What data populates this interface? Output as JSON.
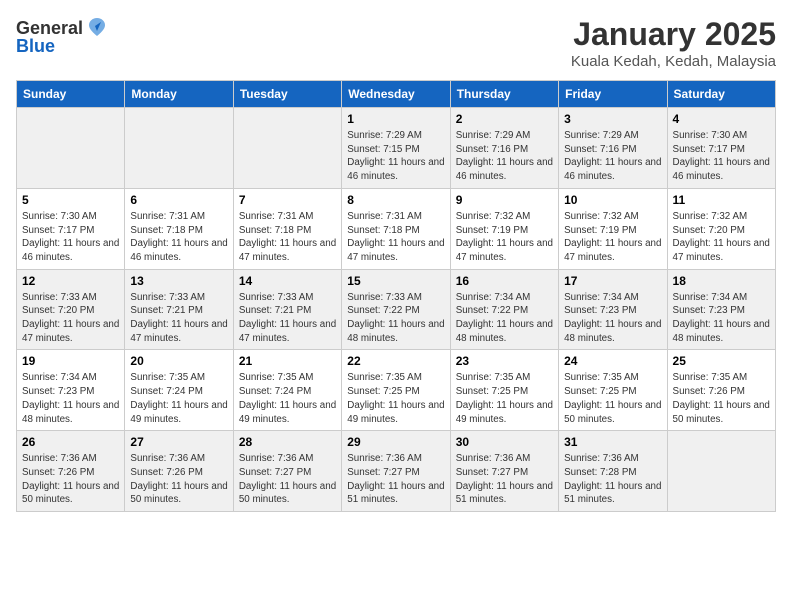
{
  "logo": {
    "general": "General",
    "blue": "Blue"
  },
  "title": "January 2025",
  "location": "Kuala Kedah, Kedah, Malaysia",
  "weekdays": [
    "Sunday",
    "Monday",
    "Tuesday",
    "Wednesday",
    "Thursday",
    "Friday",
    "Saturday"
  ],
  "weeks": [
    [
      {
        "day": "",
        "sunrise": "",
        "sunset": "",
        "daylight": ""
      },
      {
        "day": "",
        "sunrise": "",
        "sunset": "",
        "daylight": ""
      },
      {
        "day": "",
        "sunrise": "",
        "sunset": "",
        "daylight": ""
      },
      {
        "day": "1",
        "sunrise": "Sunrise: 7:29 AM",
        "sunset": "Sunset: 7:15 PM",
        "daylight": "Daylight: 11 hours and 46 minutes."
      },
      {
        "day": "2",
        "sunrise": "Sunrise: 7:29 AM",
        "sunset": "Sunset: 7:16 PM",
        "daylight": "Daylight: 11 hours and 46 minutes."
      },
      {
        "day": "3",
        "sunrise": "Sunrise: 7:29 AM",
        "sunset": "Sunset: 7:16 PM",
        "daylight": "Daylight: 11 hours and 46 minutes."
      },
      {
        "day": "4",
        "sunrise": "Sunrise: 7:30 AM",
        "sunset": "Sunset: 7:17 PM",
        "daylight": "Daylight: 11 hours and 46 minutes."
      }
    ],
    [
      {
        "day": "5",
        "sunrise": "Sunrise: 7:30 AM",
        "sunset": "Sunset: 7:17 PM",
        "daylight": "Daylight: 11 hours and 46 minutes."
      },
      {
        "day": "6",
        "sunrise": "Sunrise: 7:31 AM",
        "sunset": "Sunset: 7:18 PM",
        "daylight": "Daylight: 11 hours and 46 minutes."
      },
      {
        "day": "7",
        "sunrise": "Sunrise: 7:31 AM",
        "sunset": "Sunset: 7:18 PM",
        "daylight": "Daylight: 11 hours and 47 minutes."
      },
      {
        "day": "8",
        "sunrise": "Sunrise: 7:31 AM",
        "sunset": "Sunset: 7:18 PM",
        "daylight": "Daylight: 11 hours and 47 minutes."
      },
      {
        "day": "9",
        "sunrise": "Sunrise: 7:32 AM",
        "sunset": "Sunset: 7:19 PM",
        "daylight": "Daylight: 11 hours and 47 minutes."
      },
      {
        "day": "10",
        "sunrise": "Sunrise: 7:32 AM",
        "sunset": "Sunset: 7:19 PM",
        "daylight": "Daylight: 11 hours and 47 minutes."
      },
      {
        "day": "11",
        "sunrise": "Sunrise: 7:32 AM",
        "sunset": "Sunset: 7:20 PM",
        "daylight": "Daylight: 11 hours and 47 minutes."
      }
    ],
    [
      {
        "day": "12",
        "sunrise": "Sunrise: 7:33 AM",
        "sunset": "Sunset: 7:20 PM",
        "daylight": "Daylight: 11 hours and 47 minutes."
      },
      {
        "day": "13",
        "sunrise": "Sunrise: 7:33 AM",
        "sunset": "Sunset: 7:21 PM",
        "daylight": "Daylight: 11 hours and 47 minutes."
      },
      {
        "day": "14",
        "sunrise": "Sunrise: 7:33 AM",
        "sunset": "Sunset: 7:21 PM",
        "daylight": "Daylight: 11 hours and 47 minutes."
      },
      {
        "day": "15",
        "sunrise": "Sunrise: 7:33 AM",
        "sunset": "Sunset: 7:22 PM",
        "daylight": "Daylight: 11 hours and 48 minutes."
      },
      {
        "day": "16",
        "sunrise": "Sunrise: 7:34 AM",
        "sunset": "Sunset: 7:22 PM",
        "daylight": "Daylight: 11 hours and 48 minutes."
      },
      {
        "day": "17",
        "sunrise": "Sunrise: 7:34 AM",
        "sunset": "Sunset: 7:23 PM",
        "daylight": "Daylight: 11 hours and 48 minutes."
      },
      {
        "day": "18",
        "sunrise": "Sunrise: 7:34 AM",
        "sunset": "Sunset: 7:23 PM",
        "daylight": "Daylight: 11 hours and 48 minutes."
      }
    ],
    [
      {
        "day": "19",
        "sunrise": "Sunrise: 7:34 AM",
        "sunset": "Sunset: 7:23 PM",
        "daylight": "Daylight: 11 hours and 48 minutes."
      },
      {
        "day": "20",
        "sunrise": "Sunrise: 7:35 AM",
        "sunset": "Sunset: 7:24 PM",
        "daylight": "Daylight: 11 hours and 49 minutes."
      },
      {
        "day": "21",
        "sunrise": "Sunrise: 7:35 AM",
        "sunset": "Sunset: 7:24 PM",
        "daylight": "Daylight: 11 hours and 49 minutes."
      },
      {
        "day": "22",
        "sunrise": "Sunrise: 7:35 AM",
        "sunset": "Sunset: 7:25 PM",
        "daylight": "Daylight: 11 hours and 49 minutes."
      },
      {
        "day": "23",
        "sunrise": "Sunrise: 7:35 AM",
        "sunset": "Sunset: 7:25 PM",
        "daylight": "Daylight: 11 hours and 49 minutes."
      },
      {
        "day": "24",
        "sunrise": "Sunrise: 7:35 AM",
        "sunset": "Sunset: 7:25 PM",
        "daylight": "Daylight: 11 hours and 50 minutes."
      },
      {
        "day": "25",
        "sunrise": "Sunrise: 7:35 AM",
        "sunset": "Sunset: 7:26 PM",
        "daylight": "Daylight: 11 hours and 50 minutes."
      }
    ],
    [
      {
        "day": "26",
        "sunrise": "Sunrise: 7:36 AM",
        "sunset": "Sunset: 7:26 PM",
        "daylight": "Daylight: 11 hours and 50 minutes."
      },
      {
        "day": "27",
        "sunrise": "Sunrise: 7:36 AM",
        "sunset": "Sunset: 7:26 PM",
        "daylight": "Daylight: 11 hours and 50 minutes."
      },
      {
        "day": "28",
        "sunrise": "Sunrise: 7:36 AM",
        "sunset": "Sunset: 7:27 PM",
        "daylight": "Daylight: 11 hours and 50 minutes."
      },
      {
        "day": "29",
        "sunrise": "Sunrise: 7:36 AM",
        "sunset": "Sunset: 7:27 PM",
        "daylight": "Daylight: 11 hours and 51 minutes."
      },
      {
        "day": "30",
        "sunrise": "Sunrise: 7:36 AM",
        "sunset": "Sunset: 7:27 PM",
        "daylight": "Daylight: 11 hours and 51 minutes."
      },
      {
        "day": "31",
        "sunrise": "Sunrise: 7:36 AM",
        "sunset": "Sunset: 7:28 PM",
        "daylight": "Daylight: 11 hours and 51 minutes."
      },
      {
        "day": "",
        "sunrise": "",
        "sunset": "",
        "daylight": ""
      }
    ]
  ]
}
